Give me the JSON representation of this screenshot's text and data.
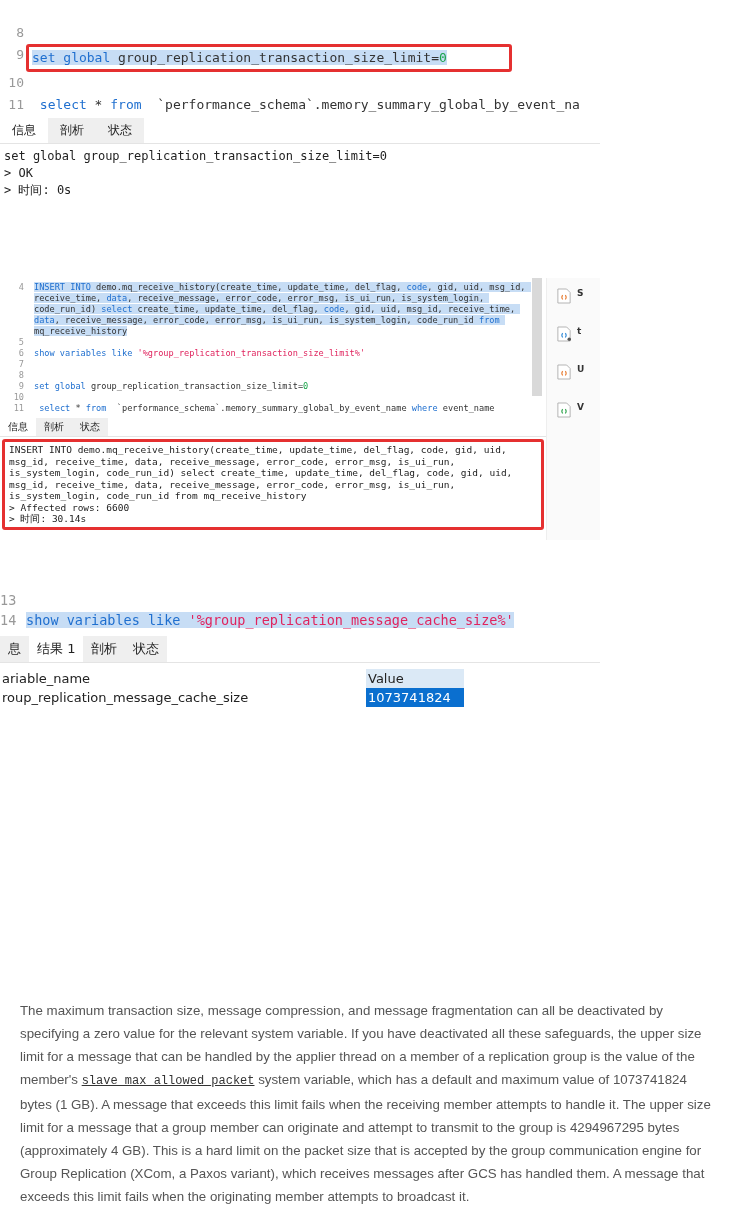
{
  "query_panels": [
    {
      "kind": "message",
      "editor": {
        "lines": [
          {
            "number": "8",
            "selected": false,
            "boxed": false
          },
          {
            "number": "9",
            "selected": true,
            "boxed": true,
            "tokens": [
              {
                "kind": "kw",
                "text": "set global"
              },
              {
                "kind": "plain",
                "text": " group_replication_transaction_size_limit="
              },
              {
                "kind": "num",
                "text": "0"
              }
            ]
          },
          {
            "number": "10",
            "selected": false,
            "boxed": false
          },
          {
            "number": "11",
            "selected": false,
            "boxed": false,
            "tokens": [
              {
                "kind": "kw",
                "text": " select"
              },
              {
                "kind": "plain",
                "text": " * "
              },
              {
                "kind": "kw",
                "text": "from"
              },
              {
                "kind": "plain",
                "text": "  `performance_schema`.memory_summary_global_by_event_na"
              }
            ]
          }
        ]
      },
      "tabs": [
        {
          "label": "信息",
          "selected": true
        },
        {
          "label": "剖析",
          "selected": false
        },
        {
          "label": "状态",
          "selected": false
        }
      ],
      "output": {
        "boxed": false,
        "lines": [
          "set global group_replication_transaction_size_limit=0",
          "> OK",
          "> 时间: 0s"
        ]
      }
    },
    {
      "kind": "message",
      "editor": {
        "lines": [
          {
            "number": "4",
            "selected": true,
            "boxed": false,
            "tokens": [
              {
                "kind": "kw",
                "text": "INSERT INTO"
              },
              {
                "kind": "plain",
                "text": " demo.mq_receive_history(create_time, update_time, del_flag, "
              },
              {
                "kind": "kw",
                "text": "code"
              },
              {
                "kind": "plain",
                "text": ", gid, uid, msg_id, receive_time, "
              },
              {
                "kind": "kw",
                "text": "data"
              },
              {
                "kind": "plain",
                "text": ", receive_message, error_code, error_msg, is_ui_run, is_system_login, code_run_id) "
              },
              {
                "kind": "kw",
                "text": "select"
              },
              {
                "kind": "plain",
                "text": " create_time, update_time, del_flag, "
              },
              {
                "kind": "kw",
                "text": "code"
              },
              {
                "kind": "plain",
                "text": ", gid, uid, msg_id, receive_time, "
              },
              {
                "kind": "kw",
                "text": "data"
              },
              {
                "kind": "plain",
                "text": ", receive_message, error_code, error_msg, is_ui_run, is_system_login, code_run_id "
              },
              {
                "kind": "kw",
                "text": "from"
              },
              {
                "kind": "plain",
                "text": " mq_receive_history"
              }
            ]
          },
          {
            "number": "5",
            "selected": false,
            "boxed": false
          },
          {
            "number": "6",
            "selected": false,
            "boxed": false,
            "tokens": [
              {
                "kind": "kw",
                "text": "show variables like "
              },
              {
                "kind": "str",
                "text": "'%group_replication_transaction_size_limit%'"
              }
            ]
          },
          {
            "number": "7",
            "selected": false,
            "boxed": false
          },
          {
            "number": "8",
            "selected": false,
            "boxed": false
          },
          {
            "number": "9",
            "selected": false,
            "boxed": false,
            "tokens": [
              {
                "kind": "kw",
                "text": "set global"
              },
              {
                "kind": "plain",
                "text": " group_replication_transaction_size_limit="
              },
              {
                "kind": "num",
                "text": "0"
              }
            ]
          },
          {
            "number": "10",
            "selected": false,
            "boxed": false
          },
          {
            "number": "11",
            "selected": false,
            "boxed": false,
            "tokens": [
              {
                "kind": "kw",
                "text": " select"
              },
              {
                "kind": "plain",
                "text": " * "
              },
              {
                "kind": "kw",
                "text": "from"
              },
              {
                "kind": "plain",
                "text": "  `performance_schema`.memory_summary_global_by_event_name "
              },
              {
                "kind": "kw",
                "text": "where"
              },
              {
                "kind": "plain",
                "text": " event_name"
              }
            ]
          }
        ]
      },
      "tabs": [
        {
          "label": "信息",
          "selected": true
        },
        {
          "label": "剖析",
          "selected": false
        },
        {
          "label": "状态",
          "selected": false
        }
      ],
      "output": {
        "boxed": true,
        "lines": [
          "INSERT INTO demo.mq_receive_history(create_time, update_time, del_flag, code, gid, uid, msg_id, receive_time, data, receive_message, error_code, error_msg, is_ui_run, is_system_login, code_run_id) select create_time, update_time, del_flag, code, gid, uid, msg_id, receive_time, data, receive_message, error_code, error_msg, is_ui_run, is_system_login, code_run_id from mq_receive_history",
          "> Affected rows: 6600",
          "> 时间: 30.14s"
        ]
      },
      "sidebar": [
        {
          "kind": "code",
          "title": "S"
        },
        {
          "kind": "code-user",
          "title": "t"
        },
        {
          "kind": "code",
          "title": "U"
        },
        {
          "kind": "code-green",
          "title": "V"
        }
      ]
    },
    {
      "kind": "table",
      "editor": {
        "lines": [
          {
            "number": "13",
            "selected": false,
            "boxed": false
          },
          {
            "number": "14",
            "selected": true,
            "boxed": false,
            "tokens": [
              {
                "kind": "kw",
                "text": "show variables like "
              },
              {
                "kind": "str",
                "text": "'%group_replication_message_cache_size%'"
              }
            ]
          }
        ]
      },
      "tabs": [
        {
          "label": "息",
          "selected": false
        },
        {
          "label": "结果 1",
          "selected": true
        },
        {
          "label": "剖析",
          "selected": false
        },
        {
          "label": "状态",
          "selected": false
        }
      ],
      "table": {
        "columns": [
          "ariable_name",
          "Value"
        ],
        "rows": [
          {
            "cells": [
              {
                "text": "roup_replication_message_cache_size",
                "selected": false
              },
              {
                "text": "1073741824",
                "selected": true
              }
            ]
          }
        ]
      }
    }
  ],
  "documentation": {
    "before": "The maximum transaction size, message compression, and message fragmentation can all be deactivated by specifying a zero value for the relevant system variable. If you have deactivated all these safeguards, the upper size limit for a message that can be handled by the applier thread on a member of a replication group is the value of the member's ",
    "code_link": "slave_max_allowed_packet",
    "after": " system variable, which has a default and maximum value of 1073741824 bytes (1 GB). A message that exceeds this limit fails when the receiving member attempts to handle it. The upper size limit for a message that a group member can originate and attempt to transmit to the group is 4294967295 bytes (approximately 4 GB). This is a hard limit on the packet size that is accepted by the group communication engine for Group Replication (XCom, a Paxos variant), which receives messages after GCS has handled them. A message that exceeds this limit fails when the originating member attempts to broadcast it."
  }
}
